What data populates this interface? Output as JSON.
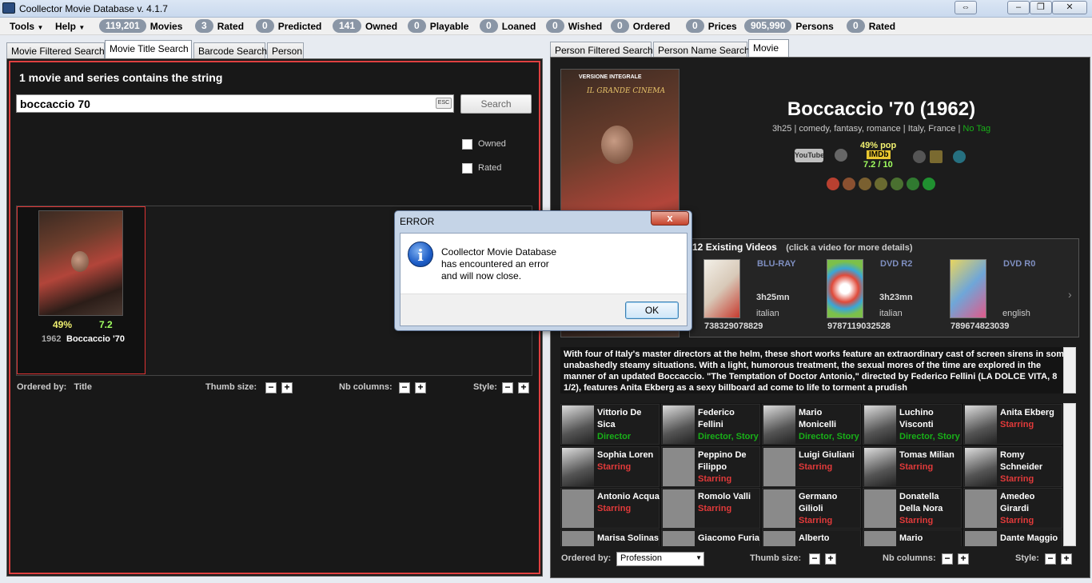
{
  "window": {
    "title": "Coollector Movie Database  v. 4.1.7"
  },
  "menu": {
    "tools": "Tools",
    "help": "Help"
  },
  "stats": [
    {
      "count": "119,201",
      "label": "Movies"
    },
    {
      "count": "3",
      "label": "Rated"
    },
    {
      "count": "0",
      "label": "Predicted"
    },
    {
      "count": "141",
      "label": "Owned"
    },
    {
      "count": "0",
      "label": "Playable"
    },
    {
      "count": "0",
      "label": "Loaned"
    },
    {
      "count": "0",
      "label": "Wished"
    },
    {
      "count": "0",
      "label": "Ordered"
    },
    {
      "count": "0",
      "label": "Prices"
    },
    {
      "count": "905,990",
      "label": "Persons"
    },
    {
      "count": "0",
      "label": "Rated"
    }
  ],
  "left_tabs": [
    "Movie Filtered Search",
    "Movie Title Search",
    "Barcode Search",
    "Person"
  ],
  "right_tabs": [
    "Person Filtered Search",
    "Person Name Search",
    "Movie"
  ],
  "search": {
    "heading": "1 movie and series contains the string",
    "value": "boccaccio 70",
    "esc": "ESC",
    "button": "Search",
    "owned_label": "Owned",
    "rated_label": "Rated"
  },
  "result": {
    "pop": "49%",
    "rating": "7.2",
    "year": "1962",
    "title": "Boccaccio '70"
  },
  "left_footer": {
    "ordered_by": "Ordered by:",
    "ordered_value": "Title",
    "thumb_size": "Thumb size:",
    "nb_columns": "Nb columns:",
    "style": "Style:",
    "minus": "−",
    "plus": "+"
  },
  "dialog": {
    "title": "ERROR",
    "close": "x",
    "message_lines": [
      "Coollector Movie Database",
      "has encountered an error",
      "and will now close."
    ],
    "ok": "OK",
    "icon": "i"
  },
  "movie": {
    "title": "Boccaccio '70 (1962)",
    "meta": "3h25 | comedy, fantasy, romance | Italy, France |",
    "tag": "No Tag",
    "pop": "49% pop",
    "imdb": "IMDb",
    "imdb_rating": "7.2 / 10",
    "youtube": "YouTube",
    "poster_top": "VERSIONE INTEGRALE",
    "poster_name": "IL GRANDE CINEMA"
  },
  "videos": {
    "count": "12",
    "label": "Existing Videos",
    "hint": "(click a video for more details)",
    "items": [
      {
        "format": "BLU-RAY",
        "duration": "3h25mn",
        "lang": "italian",
        "barcode": "738329078829"
      },
      {
        "format": "DVD R2",
        "duration": "3h23mn",
        "lang": "italian",
        "barcode": "9787119032528"
      },
      {
        "format": "DVD R0",
        "duration": "",
        "lang": "english",
        "barcode": "789674823039"
      }
    ]
  },
  "synopsis": "With four of Italy's master directors at the helm, these short works feature an extraordinary cast of screen sirens in some unabashedly steamy situations. With a light, humorous treatment, the sexual mores of the time are explored in the manner of an updated Boccaccio. \"The Temptation of Doctor Antonio,\" directed by Federico Fellini (LA DOLCE VITA, 8 1/2), features Anita Ekberg as a sexy billboard ad come to life to torment a prudish",
  "cast": [
    [
      {
        "name": "Vittorio De Sica",
        "role": "Director",
        "color": "green",
        "photo": true
      },
      {
        "name": "Federico Fellini",
        "role": "Director, Story",
        "color": "green",
        "photo": true
      },
      {
        "name": "Mario Monicelli",
        "role": "Director, Story",
        "color": "green",
        "photo": true
      },
      {
        "name": "Luchino Visconti",
        "role": "Director, Story",
        "color": "green",
        "photo": true
      },
      {
        "name": "Anita Ekberg",
        "role": "Starring",
        "color": "red",
        "photo": true
      }
    ],
    [
      {
        "name": "Sophia Loren",
        "role": "Starring",
        "color": "red",
        "photo": true
      },
      {
        "name": "Peppino De Filippo",
        "role": "Starring",
        "color": "red",
        "photo": false
      },
      {
        "name": "Luigi Giuliani",
        "role": "Starring",
        "color": "red",
        "photo": false
      },
      {
        "name": "Tomas Milian",
        "role": "Starring",
        "color": "red",
        "photo": true
      },
      {
        "name": "Romy Schneider",
        "role": "Starring",
        "color": "red",
        "photo": true
      }
    ],
    [
      {
        "name": "Antonio Acqua",
        "role": "Starring",
        "color": "red",
        "photo": false
      },
      {
        "name": "Romolo Valli",
        "role": "Starring",
        "color": "red",
        "photo": false
      },
      {
        "name": "Germano Gilioli",
        "role": "Starring",
        "color": "red",
        "photo": false
      },
      {
        "name": "Donatella Della Nora",
        "role": "Starring",
        "color": "red",
        "photo": false
      },
      {
        "name": "Amedeo Girardi",
        "role": "Starring",
        "color": "red",
        "photo": false
      }
    ],
    [
      {
        "name": "Marisa Solinas",
        "role": "",
        "color": "red",
        "photo": false
      },
      {
        "name": "Giacomo Furia",
        "role": "",
        "color": "red",
        "photo": false
      },
      {
        "name": "Alberto",
        "role": "",
        "color": "red",
        "photo": false
      },
      {
        "name": "Mario",
        "role": "",
        "color": "red",
        "photo": false
      },
      {
        "name": "Dante Maggio",
        "role": "",
        "color": "red",
        "photo": false
      }
    ]
  ],
  "right_footer": {
    "ordered_by": "Ordered by:",
    "ordered_value": "Profession",
    "thumb_size": "Thumb size:",
    "nb_columns": "Nb columns:",
    "style": "Style:",
    "minus": "−",
    "plus": "+"
  }
}
